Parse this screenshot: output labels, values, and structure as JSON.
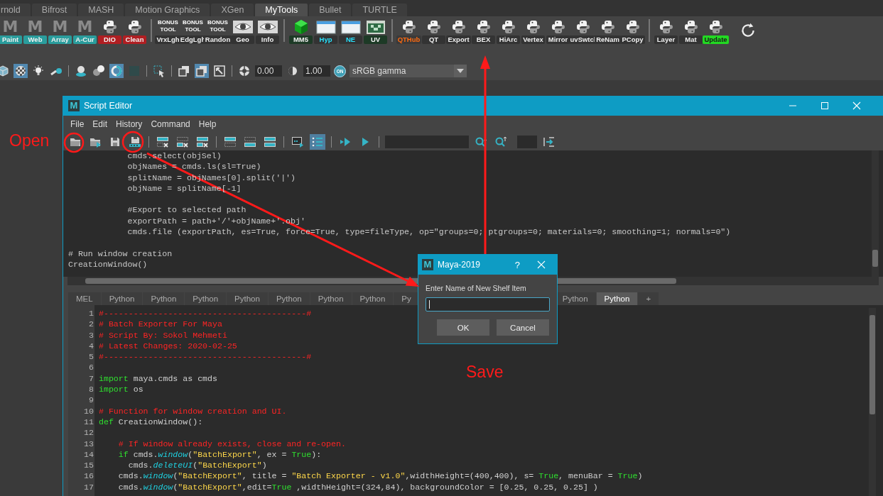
{
  "shelf": {
    "tabs": [
      {
        "label": "rnold",
        "selected": false
      },
      {
        "label": "Bifrost",
        "selected": false
      },
      {
        "label": "MASH",
        "selected": false
      },
      {
        "label": "Motion Graphics",
        "selected": false
      },
      {
        "label": "XGen",
        "selected": false
      },
      {
        "label": "MyTools",
        "selected": true
      },
      {
        "label": "Bullet",
        "selected": false
      },
      {
        "label": "TURTLE",
        "selected": false
      }
    ],
    "groups": [
      [
        {
          "kind": "maya",
          "icon_text": "M",
          "label": "Paint",
          "color": "#2a9d9d"
        },
        {
          "kind": "maya",
          "icon_text": "M",
          "label": "Web",
          "color": "#2a9d9d"
        },
        {
          "kind": "maya",
          "icon_text": "M",
          "label": "Array",
          "color": "#2a9d9d"
        },
        {
          "kind": "maya",
          "icon_text": "M",
          "label": "A-Cur",
          "color": "#2a9d9d"
        },
        {
          "kind": "python",
          "label": "DIO",
          "color": "#b01e22"
        },
        {
          "kind": "python",
          "label": "Clean",
          "color": "#b01e22"
        }
      ],
      [
        {
          "kind": "bonus",
          "icon_text": "BONUS TOOL",
          "label": "VrxLgh",
          "color": "#333333"
        },
        {
          "kind": "bonus",
          "icon_text": "BONUS TOOL",
          "label": "EdgLgh",
          "color": "#333333"
        },
        {
          "kind": "bonus",
          "icon_text": "BONUS TOOL",
          "label": "Randon",
          "color": "#333333"
        },
        {
          "kind": "eye",
          "label": "Geo",
          "color": "#333333"
        },
        {
          "kind": "eye",
          "label": "Info",
          "color": "#333333"
        }
      ],
      [
        {
          "kind": "cube",
          "label": "MM5",
          "color": "#1d3a26"
        },
        {
          "kind": "window",
          "label": {
            "text": "Hyp",
            "color": "#27e3ff"
          },
          "color": "#333333"
        },
        {
          "kind": "window",
          "label": {
            "text": "NE",
            "color": "#27e3ff"
          },
          "color": "#333333"
        },
        {
          "kind": "uv",
          "label": "UV",
          "color": "#1d3a26"
        }
      ],
      [
        {
          "kind": "python",
          "label": {
            "text": "QTHub",
            "color": "#ff6a10"
          },
          "color": "#3a3a3a"
        },
        {
          "kind": "python",
          "label": "QT",
          "color": "#333333"
        },
        {
          "kind": "python",
          "label": "Export",
          "color": "#333333"
        },
        {
          "kind": "python",
          "label": "BEX",
          "color": "#333333"
        },
        {
          "kind": "python",
          "label": "HiArc",
          "color": "#333333"
        },
        {
          "kind": "python",
          "label": "Vertex",
          "color": "#333333"
        },
        {
          "kind": "python",
          "label": "Mirror",
          "color": "#333333"
        },
        {
          "kind": "python",
          "label": "uvSwtcl",
          "color": "#333333"
        },
        {
          "kind": "python",
          "label": "ReNam",
          "color": "#333333"
        },
        {
          "kind": "python",
          "label": "PCopy",
          "color": "#333333"
        }
      ],
      [
        {
          "kind": "python",
          "label": "Layer",
          "color": "#333333"
        },
        {
          "kind": "python",
          "label": "Mat",
          "color": "#333333"
        },
        {
          "kind": "python",
          "label": "Update",
          "color": "#22d822"
        }
      ]
    ]
  },
  "viewport_toolbar": {
    "items": [
      {
        "kind": "cube",
        "selected": false
      },
      {
        "kind": "checker",
        "selected": true
      },
      {
        "kind": "bulb",
        "selected": false
      },
      {
        "kind": "lights",
        "selected": false
      },
      {
        "kind": "separator"
      },
      {
        "kind": "shadow-sphere",
        "selected": false
      },
      {
        "kind": "spheres",
        "selected": false
      },
      {
        "kind": "ring",
        "selected": true
      },
      {
        "kind": "dark-square",
        "selected": false
      },
      {
        "kind": "separator"
      },
      {
        "kind": "select-arrow",
        "selected": false
      },
      {
        "kind": "separator"
      },
      {
        "kind": "squares",
        "selected": false
      },
      {
        "kind": "squares",
        "selected": true
      },
      {
        "kind": "frame",
        "selected": false
      },
      {
        "kind": "separator"
      },
      {
        "kind": "aperture",
        "selected": false
      },
      {
        "kind": "field",
        "value": "0.00"
      },
      {
        "kind": "halfmoon",
        "selected": false
      },
      {
        "kind": "field",
        "value": "1.00"
      },
      {
        "kind": "toggle",
        "text": "ON"
      },
      {
        "kind": "dropdown",
        "value": "sRGB gamma"
      }
    ]
  },
  "script_editor": {
    "title": "Script Editor",
    "icon_text": "M",
    "menu": [
      "File",
      "Edit",
      "History",
      "Command",
      "Help"
    ],
    "toolbar": [
      {
        "kind": "folder",
        "selected": false
      },
      {
        "kind": "folder-play",
        "selected": false
      },
      {
        "kind": "floppy",
        "selected": false
      },
      {
        "kind": "floppy-strip",
        "selected": false
      },
      {
        "kind": "separator"
      },
      {
        "kind": "panel-cross-top",
        "selected": false
      },
      {
        "kind": "panel-cross-bottom",
        "selected": false
      },
      {
        "kind": "panel-cross-both",
        "selected": false
      },
      {
        "kind": "separator"
      },
      {
        "kind": "panel-top",
        "selected": false
      },
      {
        "kind": "panel-bottom",
        "selected": false
      },
      {
        "kind": "panel-both",
        "selected": false
      },
      {
        "kind": "separator"
      },
      {
        "kind": "echo",
        "selected": false
      },
      {
        "kind": "numbered-list",
        "selected": true
      },
      {
        "kind": "separator"
      },
      {
        "kind": "double-play",
        "selected": false
      },
      {
        "kind": "play",
        "selected": false
      },
      {
        "kind": "separator"
      },
      {
        "kind": "wide-field"
      },
      {
        "kind": "search-down",
        "selected": false
      },
      {
        "kind": "search-up",
        "selected": false
      },
      {
        "kind": "narrow-field"
      },
      {
        "kind": "tab-indent",
        "selected": false
      }
    ],
    "history": [
      {
        "kind": "code",
        "text": "            cmds.select(objSel)"
      },
      {
        "kind": "code",
        "text": "            objNames = cmds.ls(sl=True)"
      },
      {
        "kind": "code",
        "text": "            splitName = objNames[0].split('|')"
      },
      {
        "kind": "code",
        "text": "            objName = splitName[-1]"
      },
      {
        "kind": "blank"
      },
      {
        "kind": "code",
        "text": "            #Export to selected path"
      },
      {
        "kind": "code",
        "text": "            exportPath = path+'/'+objName+'.obj'"
      },
      {
        "kind": "code",
        "text": "            cmds.file (exportPath, es=True, force=True, type=fileType, op=\"groups=0; ptgroups=0; materials=0; smoothing=1; normals=0\")"
      },
      {
        "kind": "blank"
      },
      {
        "kind": "code",
        "text": "# Run window creation"
      },
      {
        "kind": "code",
        "text": "CreationWindow()"
      }
    ],
    "tabs": [
      {
        "label": "MEL",
        "selected": false
      },
      {
        "label": "Python",
        "selected": false
      },
      {
        "label": "Python",
        "selected": false
      },
      {
        "label": "Python",
        "selected": false
      },
      {
        "label": "Python",
        "selected": false
      },
      {
        "label": "Python",
        "selected": false
      },
      {
        "label": "Python",
        "selected": false
      },
      {
        "label": "Python",
        "selected": false
      },
      {
        "label": "Py",
        "selected": false
      }
    ],
    "tabs_right": [
      {
        "label": "Python",
        "selected": false
      },
      {
        "label": "Python",
        "selected": true
      },
      {
        "label": "+",
        "selected": false
      }
    ],
    "input": [
      {
        "number": "1",
        "segments": [
          {
            "kind": "comment",
            "text": "#-----------------------------------------#"
          }
        ]
      },
      {
        "number": "2",
        "segments": [
          {
            "kind": "comment",
            "text": "# Batch Exporter For Maya"
          }
        ]
      },
      {
        "number": "3",
        "segments": [
          {
            "kind": "comment",
            "text": "# Script By: Sokol Mehmeti"
          }
        ]
      },
      {
        "number": "4",
        "segments": [
          {
            "kind": "comment",
            "text": "# Latest Changes: 2020-02-25"
          }
        ]
      },
      {
        "number": "5",
        "segments": [
          {
            "kind": "comment",
            "text": "#-----------------------------------------#"
          }
        ]
      },
      {
        "number": "6"
      },
      {
        "number": "7",
        "segments": [
          {
            "kind": "keyword",
            "text": "import"
          },
          {
            "kind": "plain",
            "text": " maya.cmds as cmds"
          }
        ]
      },
      {
        "number": "8",
        "segments": [
          {
            "kind": "keyword",
            "text": "import"
          },
          {
            "kind": "plain",
            "text": " os"
          }
        ]
      },
      {
        "number": "9"
      },
      {
        "number": "10",
        "segments": [
          {
            "kind": "comment",
            "text": "# Function for window creation and UI."
          }
        ]
      },
      {
        "number": "11",
        "segments": [
          {
            "kind": "keyword",
            "text": "def"
          },
          {
            "kind": "plain",
            "text": " CreationWindow():"
          }
        ]
      },
      {
        "number": "12"
      },
      {
        "number": "13",
        "segments": [
          {
            "kind": "comment",
            "text": "    # If window already exists, close and re-open."
          }
        ]
      },
      {
        "number": "14",
        "segments": [
          {
            "kind": "keyword",
            "text": "    if"
          },
          {
            "kind": "plain",
            "text": " cmds."
          },
          {
            "kind": "func",
            "text": "window"
          },
          {
            "kind": "plain",
            "text": "("
          },
          {
            "kind": "string",
            "text": "\"BatchExport\""
          },
          {
            "kind": "plain",
            "text": ", ex = "
          },
          {
            "kind": "keyword",
            "text": "True"
          },
          {
            "kind": "plain",
            "text": "):"
          }
        ]
      },
      {
        "number": "15",
        "segments": [
          {
            "kind": "plain",
            "text": "      cmds."
          },
          {
            "kind": "func",
            "text": "deleteUI"
          },
          {
            "kind": "plain",
            "text": "("
          },
          {
            "kind": "string",
            "text": "\"BatchExport\""
          },
          {
            "kind": "plain",
            "text": ")"
          }
        ]
      },
      {
        "number": "16",
        "segments": [
          {
            "kind": "plain",
            "text": "    cmds."
          },
          {
            "kind": "func",
            "text": "window"
          },
          {
            "kind": "plain",
            "text": "("
          },
          {
            "kind": "string",
            "text": "\"BatchExport\""
          },
          {
            "kind": "plain",
            "text": ", title = "
          },
          {
            "kind": "string",
            "text": "\"Batch Exporter - v1.0\""
          },
          {
            "kind": "plain",
            "text": ",widthHeight=(400,400), s= "
          },
          {
            "kind": "keyword",
            "text": "True"
          },
          {
            "kind": "plain",
            "text": ", menuBar = "
          },
          {
            "kind": "keyword",
            "text": "True"
          },
          {
            "kind": "plain",
            "text": ")"
          }
        ]
      },
      {
        "number": "17",
        "segments": [
          {
            "kind": "plain",
            "text": "    cmds."
          },
          {
            "kind": "func",
            "text": "window"
          },
          {
            "kind": "plain",
            "text": "("
          },
          {
            "kind": "string",
            "text": "\"BatchExport\""
          },
          {
            "kind": "plain",
            "text": ",edit="
          },
          {
            "kind": "keyword",
            "text": "True"
          },
          {
            "kind": "plain",
            "text": " ,widthHeight=(324,84), backgroundColor = [0.25, 0.25, 0.25] )"
          }
        ]
      }
    ]
  },
  "dialog": {
    "title": "Maya-2019",
    "icon_text": "M",
    "help": "?",
    "prompt": "Enter Name of New Shelf Item",
    "field": {
      "focused": true
    },
    "buttons": [
      "OK",
      "Cancel"
    ]
  },
  "annotations": [
    {
      "text": "Open"
    },
    {
      "text": "Save"
    }
  ]
}
